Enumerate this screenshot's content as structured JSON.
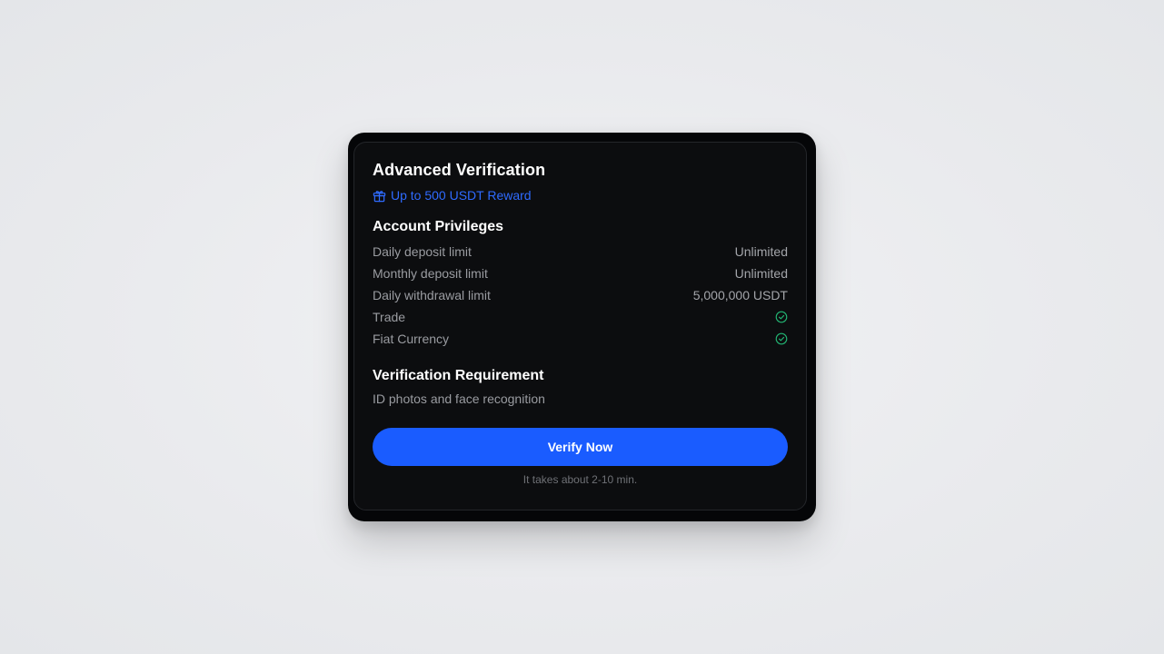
{
  "card": {
    "title": "Advanced Verification",
    "reward": {
      "icon": "gift-icon",
      "text": "Up to 500 USDT Reward",
      "color": "#2f6bff"
    },
    "privileges": {
      "title": "Account Privileges",
      "rows": [
        {
          "label": "Daily deposit limit",
          "value": "Unlimited"
        },
        {
          "label": "Monthly deposit limit",
          "value": "Unlimited"
        },
        {
          "label": "Daily withdrawal limit",
          "value": "5,000,000 USDT"
        },
        {
          "label": "Trade",
          "value": "",
          "icon": "check-circle-icon"
        },
        {
          "label": "Fiat Currency",
          "value": "",
          "icon": "check-circle-icon"
        }
      ],
      "check_color": "#22b573"
    },
    "requirement": {
      "title": "Verification Requirement",
      "text": "ID photos and face recognition"
    },
    "button": {
      "label": "Verify Now",
      "color": "#1a5cff"
    },
    "time_note": "It takes about 2-10 min."
  }
}
